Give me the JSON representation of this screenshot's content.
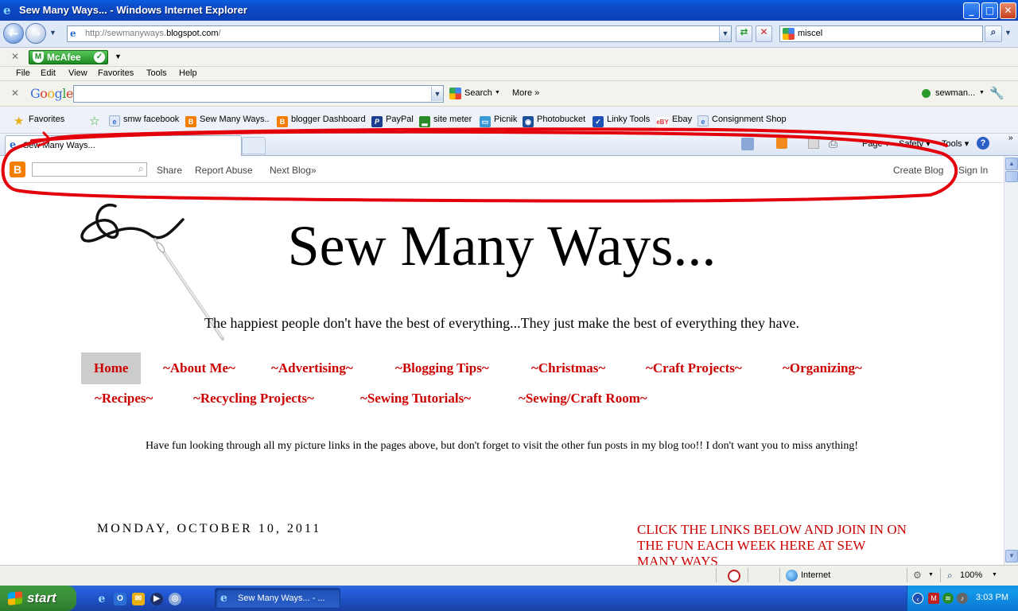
{
  "window": {
    "title": "Sew Many Ways... - Windows Internet Explorer",
    "controls": {
      "minimize": "_",
      "maximize": "□",
      "close": "✕"
    }
  },
  "address_bar": {
    "url_prefix": "http://sewmanyways.",
    "url_domain": "blogspot.com",
    "url_suffix": "/",
    "search_value": "miscel"
  },
  "mcafee": {
    "label": "McAfee"
  },
  "menu": [
    "File",
    "Edit",
    "View",
    "Favorites",
    "Tools",
    "Help"
  ],
  "google_toolbar": {
    "logo": "Google",
    "search_label": "Search",
    "more_label": "More »",
    "account_label": "sewman..."
  },
  "favorites": {
    "label": "Favorites",
    "items": [
      {
        "label": "smw facebook",
        "icon": "page-icon"
      },
      {
        "label": "Sew Many Ways..",
        "icon": "blogger-icon"
      },
      {
        "label": "blogger Dashboard",
        "icon": "blogger-icon"
      },
      {
        "label": "PayPal",
        "icon": "paypal-icon"
      },
      {
        "label": "site meter",
        "icon": "sitemeter-icon"
      },
      {
        "label": "Picnik",
        "icon": "picnik-icon"
      },
      {
        "label": "Photobucket",
        "icon": "photobucket-icon"
      },
      {
        "label": "Linky Tools",
        "icon": "linky-icon"
      },
      {
        "label": "Ebay",
        "icon": "ebay-icon"
      },
      {
        "label": "Consignment Shop",
        "icon": "page-icon"
      }
    ]
  },
  "tab": {
    "title": "Sew Many Ways..."
  },
  "command_bar": {
    "page": "Page ▾",
    "safety": "Safety ▾",
    "tools": "Tools ▾"
  },
  "blogger_navbar": {
    "share": "Share",
    "report_abuse": "Report Abuse",
    "next_blog": "Next Blog»",
    "create_blog": "Create Blog",
    "sign_in": "Sign In"
  },
  "blog": {
    "title": "Sew Many Ways...",
    "tagline": "The happiest people don't have the best of everything...They just make the best of everything they have.",
    "pages_row1": [
      "Home",
      "~About Me~",
      "~Advertising~",
      "~Blogging Tips~",
      "~Christmas~",
      "~Craft Projects~",
      "~Organizing~"
    ],
    "pages_row2": [
      "~Recipes~",
      "~Recycling Projects~",
      "~Sewing Tutorials~",
      "~Sewing/Craft Room~"
    ],
    "notice": "Have fun looking through all my picture links in the pages above, but don't forget to visit the other fun posts in my blog too!! I don't want you to miss anything!",
    "date_header": "MONDAY, OCTOBER 10, 2011",
    "sidebar_heading": "CLICK THE LINKS BELOW AND JOIN IN ON THE FUN EACH WEEK HERE AT SEW MANY WAYS"
  },
  "status_bar": {
    "zone": "Internet",
    "zoom": "100%"
  },
  "taskbar": {
    "start": "start",
    "task_item": "Sew Many Ways... - ...",
    "clock": "3:03 PM"
  },
  "colors": {
    "accent_red": "#cc0000",
    "marker_red": "#e3000b",
    "xp_blue": "#245edb",
    "start_green": "#3a8e3a"
  }
}
